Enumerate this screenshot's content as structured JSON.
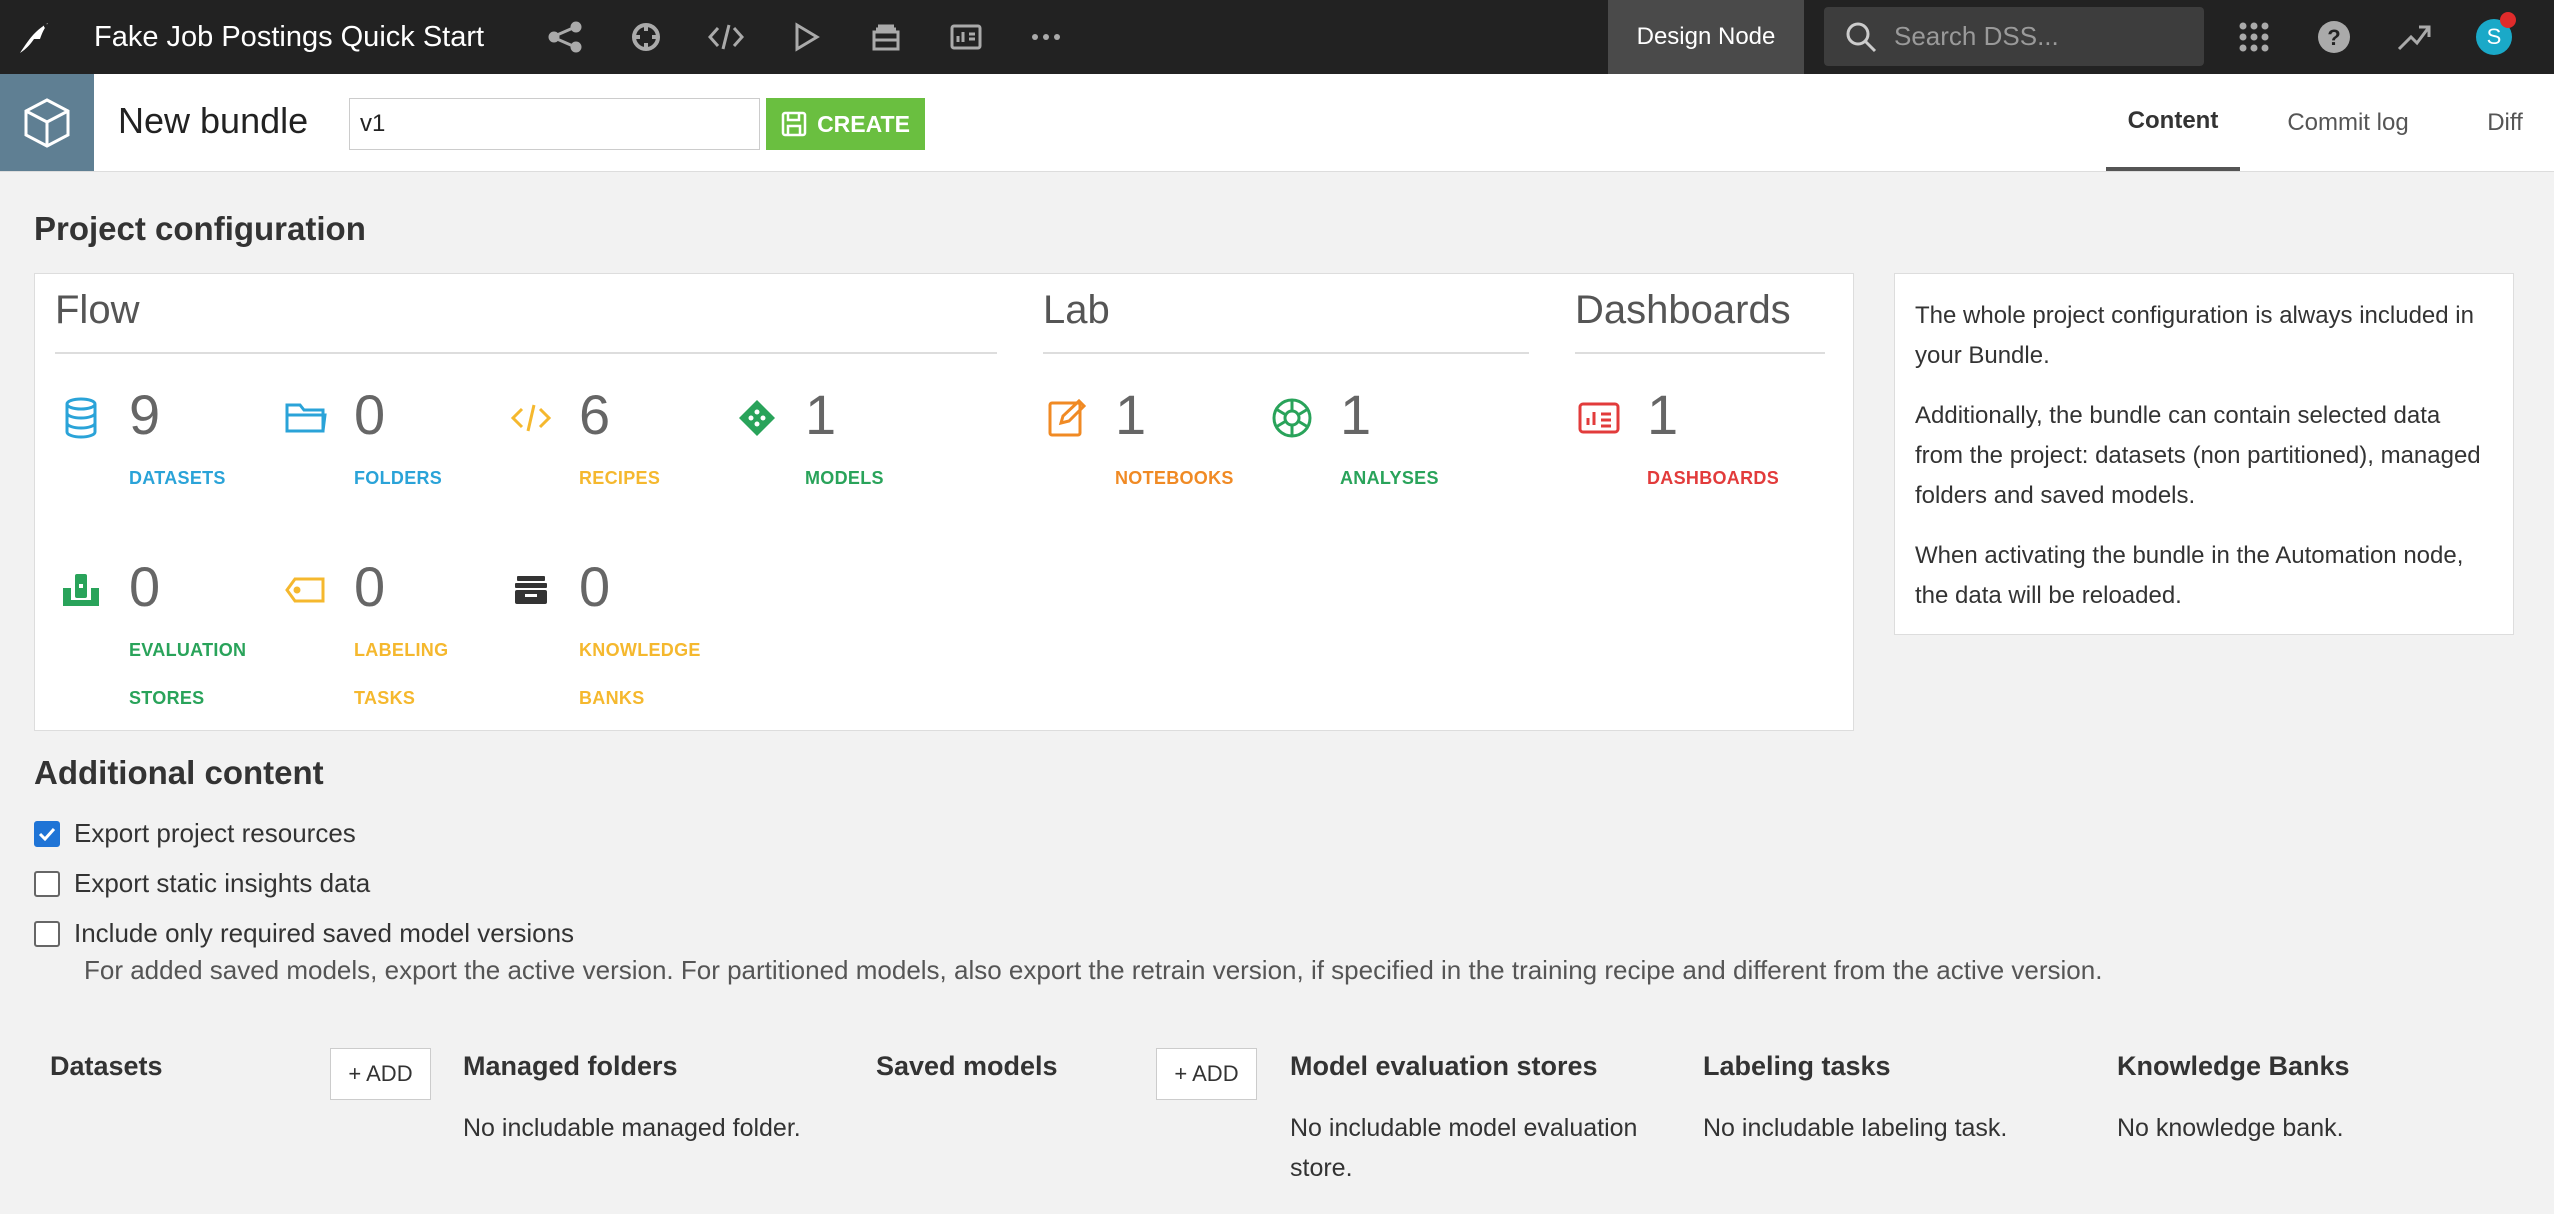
{
  "topbar": {
    "project_title": "Fake Job Postings Quick Start",
    "design_node": "Design Node",
    "search_placeholder": "Search DSS...",
    "avatar_initial": "S"
  },
  "bundle": {
    "title": "New bundle",
    "version_value": "v1",
    "create_label": "CREATE",
    "tabs": [
      "Content",
      "Commit log",
      "Diff"
    ]
  },
  "config": {
    "title": "Project configuration",
    "groups": {
      "flow": "Flow",
      "lab": "Lab",
      "dashboards": "Dashboards"
    },
    "stats": {
      "datasets": {
        "value": "9",
        "label": "DATASETS",
        "color": "#2aa3d8"
      },
      "folders": {
        "value": "0",
        "label": "FOLDERS",
        "color": "#2aa3d8"
      },
      "recipes": {
        "value": "6",
        "label": "RECIPES",
        "color": "#f5b82e"
      },
      "models": {
        "value": "1",
        "label": "MODELS",
        "color": "#29a35a"
      },
      "notebooks": {
        "value": "1",
        "label": "NOTEBOOKS",
        "color": "#f08a24"
      },
      "analyses": {
        "value": "1",
        "label": "ANALYSES",
        "color": "#29a35a"
      },
      "dashboards": {
        "value": "1",
        "label": "DASHBOARDS",
        "color": "#e23b3b"
      },
      "evaluation_stores": {
        "value": "0",
        "label": "EVALUATION STORES",
        "color": "#29a35a"
      },
      "labeling_tasks": {
        "value": "0",
        "label": "LABELING TASKS",
        "color": "#f5b82e"
      },
      "knowledge_banks": {
        "value": "0",
        "label": "KNOWLEDGE BANKS",
        "color": "#f5b82e"
      }
    },
    "info": [
      "The whole project configuration is always included in your Bundle.",
      "Additionally, the bundle can contain selected data from the project: datasets (non partitioned), managed folders and saved models.",
      "When activating the bundle in the Automation node, the data will be reloaded."
    ]
  },
  "additional": {
    "title": "Additional content",
    "options": [
      {
        "label": "Export project resources",
        "checked": true
      },
      {
        "label": "Export static insights data",
        "checked": false
      },
      {
        "label": "Include only required saved model versions",
        "checked": false
      }
    ],
    "note": "For added saved models, export the active version. For partitioned models, also export the retrain version, if specified in the training recipe and different from the active version."
  },
  "columns": {
    "datasets": "Datasets",
    "add_label": "+ ADD",
    "managed_folders": "Managed folders",
    "managed_folders_empty": "No includable managed folder.",
    "saved_models": "Saved models",
    "model_eval_stores": "Model evaluation stores",
    "model_eval_stores_empty": "No includable model evaluation store.",
    "labeling_tasks": "Labeling tasks",
    "labeling_tasks_empty": "No includable labeling task.",
    "knowledge_banks": "Knowledge Banks",
    "knowledge_banks_empty": "No knowledge bank."
  }
}
